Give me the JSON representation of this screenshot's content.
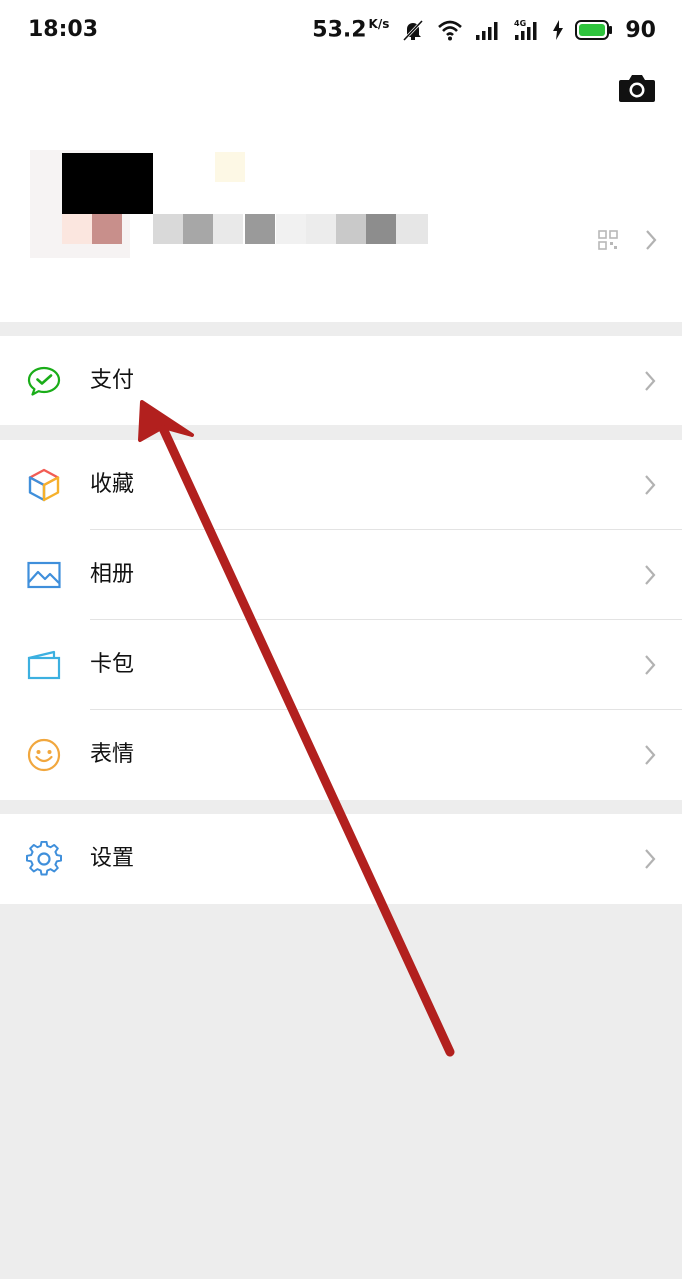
{
  "status_bar": {
    "time": "18:03",
    "net_speed": "53.2",
    "net_unit": "K/s",
    "network": "4G",
    "battery": "90",
    "battery_color": "#2fc43d"
  },
  "header": {
    "camera_icon": "camera-icon",
    "qr_icon": "qr-code-icon",
    "profile_redacted": true
  },
  "menu": {
    "groups": [
      {
        "items": [
          {
            "label": "支付",
            "icon": "wechat-pay-icon",
            "icon_color": "#1aad19"
          }
        ]
      },
      {
        "items": [
          {
            "label": "收藏",
            "icon": "favorites-cube-icon",
            "icon_color": "#f6b12c"
          },
          {
            "label": "相册",
            "icon": "album-picture-icon",
            "icon_color": "#3f8fdb"
          },
          {
            "label": "卡包",
            "icon": "card-wallet-icon",
            "icon_color": "#3cb0e0"
          },
          {
            "label": "表情",
            "icon": "emoji-smile-icon",
            "icon_color": "#f1a73e"
          }
        ]
      },
      {
        "items": [
          {
            "label": "设置",
            "icon": "settings-gear-icon",
            "icon_color": "#3f8fdb"
          }
        ]
      }
    ]
  },
  "annotation": {
    "arrow_color": "#b2201e"
  },
  "colors": {
    "page_bg": "#ededed",
    "card_bg": "#ffffff",
    "divider": "#e3e3e3",
    "chevron": "#b2b2b2"
  }
}
